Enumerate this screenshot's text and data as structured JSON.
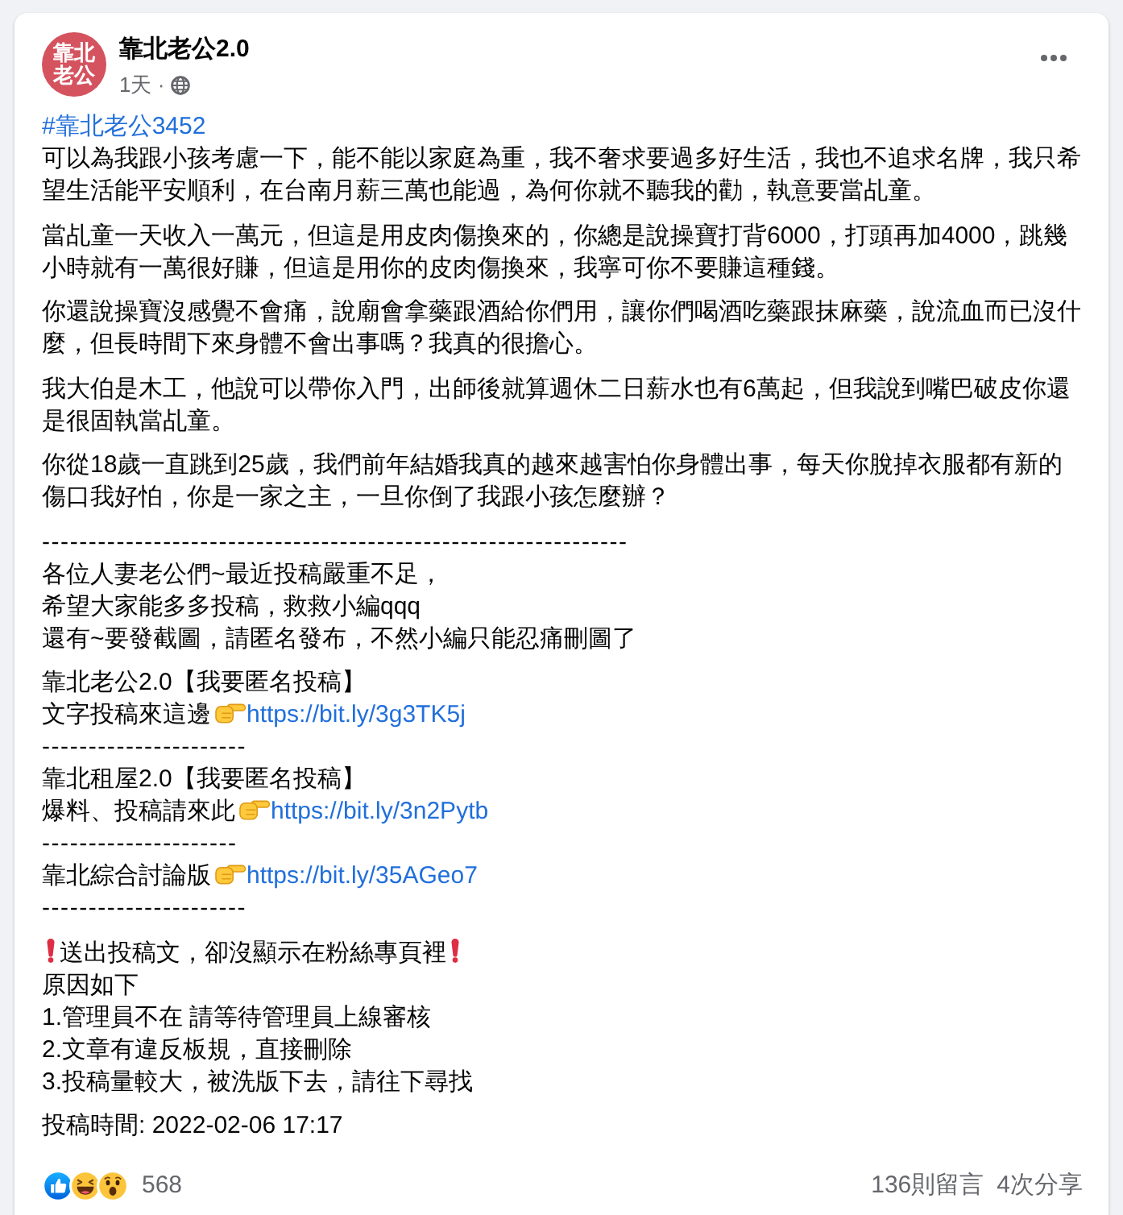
{
  "post": {
    "page": {
      "avatar_text": [
        "靠北",
        "老公"
      ],
      "name": "靠北老公2.0",
      "meta": "1天 ·"
    },
    "body": [
      {
        "kind": "paragraph",
        "hashtag": "#靠北老公3452",
        "text": "可以為我跟小孩考慮一下，能不能以家庭為重，我不奢求要過多好生活，我也不追求名牌，我只希望生活能平安順利，在台南月薪三萬也能過，為何你就不聽我的勸，執意要當乩童。"
      },
      {
        "kind": "paragraph",
        "text": "當乩童一天收入一萬元，但這是用皮肉傷換來的，你總是說操寶打背6000，打頭再加4000，跳幾小時就有一萬很好賺，但這是用你的皮肉傷換來，我寧可你不要賺這種錢。"
      },
      {
        "kind": "paragraph",
        "text": "你還說操寶沒感覺不會痛，說廟會拿藥跟酒給你們用，讓你們喝酒吃藥跟抹麻藥，說流血而已沒什麼，但長時間下來身體不會出事嗎？我真的很擔心。"
      },
      {
        "kind": "paragraph",
        "text": "我大伯是木工，他說可以帶你入門，出師後就算週休二日薪水也有6萬起，但我說到嘴巴破皮你還是很固執當乩童。"
      },
      {
        "kind": "paragraph",
        "text": "你從18歲一直跳到25歲，我們前年結婚我真的越來越害怕你身體出事，每天你脫掉衣服都有新的傷口我好怕，你是一家之主，一旦你倒了我跟小孩怎麼辦？"
      },
      {
        "kind": "lines",
        "lines": [
          [
            {
              "kind": "dashes",
              "text": "---------------------------------------------------------------"
            }
          ],
          [
            {
              "kind": "text",
              "text": "各位人妻老公們~最近投稿嚴重不足，"
            }
          ],
          [
            {
              "kind": "text",
              "text": "希望大家能多多投稿，救救小編qqq"
            }
          ],
          [
            {
              "kind": "text",
              "text": "還有~要發截圖，請匿名發布，不然小編只能忍痛刪圖了"
            }
          ]
        ]
      },
      {
        "kind": "lines",
        "lines": [
          [
            {
              "kind": "text",
              "text": "靠北老公2.0【我要匿名投稿】"
            }
          ],
          [
            {
              "kind": "text",
              "text": "文字投稿來這邊"
            },
            {
              "kind": "hand"
            },
            {
              "kind": "link",
              "text": "https://bit.ly/3g3TK5j"
            }
          ],
          [
            {
              "kind": "dashes",
              "text": "----------------------"
            }
          ],
          [
            {
              "kind": "text",
              "text": "靠北租屋2.0【我要匿名投稿】"
            }
          ],
          [
            {
              "kind": "text",
              "text": "爆料、投稿請來此"
            },
            {
              "kind": "hand"
            },
            {
              "kind": "link",
              "text": "https://bit.ly/3n2Pytb"
            }
          ],
          [
            {
              "kind": "dashes",
              "text": "---------------------"
            }
          ],
          [
            {
              "kind": "text",
              "text": "靠北綜合討論版"
            },
            {
              "kind": "hand"
            },
            {
              "kind": "link",
              "text": "https://bit.ly/35AGeo7"
            }
          ],
          [
            {
              "kind": "dashes",
              "text": "----------------------"
            }
          ]
        ]
      },
      {
        "kind": "lines",
        "lines": [
          [
            {
              "kind": "alert"
            },
            {
              "kind": "text",
              "text": "送出投稿文，卻沒顯示在粉絲專頁裡"
            },
            {
              "kind": "alert"
            }
          ],
          [
            {
              "kind": "text",
              "text": "原因如下"
            }
          ],
          [
            {
              "kind": "text",
              "text": "1.管理員不在 請等待管理員上線審核"
            }
          ],
          [
            {
              "kind": "text",
              "text": "2.文章有違反板規，直接刪除"
            }
          ],
          [
            {
              "kind": "text",
              "text": "3.投稿量較大，被洗版下去，請往下尋找"
            }
          ]
        ]
      },
      {
        "kind": "paragraph",
        "text": "投稿時間: 2022-02-06 17:17"
      }
    ],
    "footer": {
      "reactions": [
        {
          "kind": "like"
        },
        {
          "kind": "haha"
        },
        {
          "kind": "wow"
        }
      ],
      "reaction_count": "568",
      "comments": "136則留言",
      "shares": "4次分享"
    }
  }
}
